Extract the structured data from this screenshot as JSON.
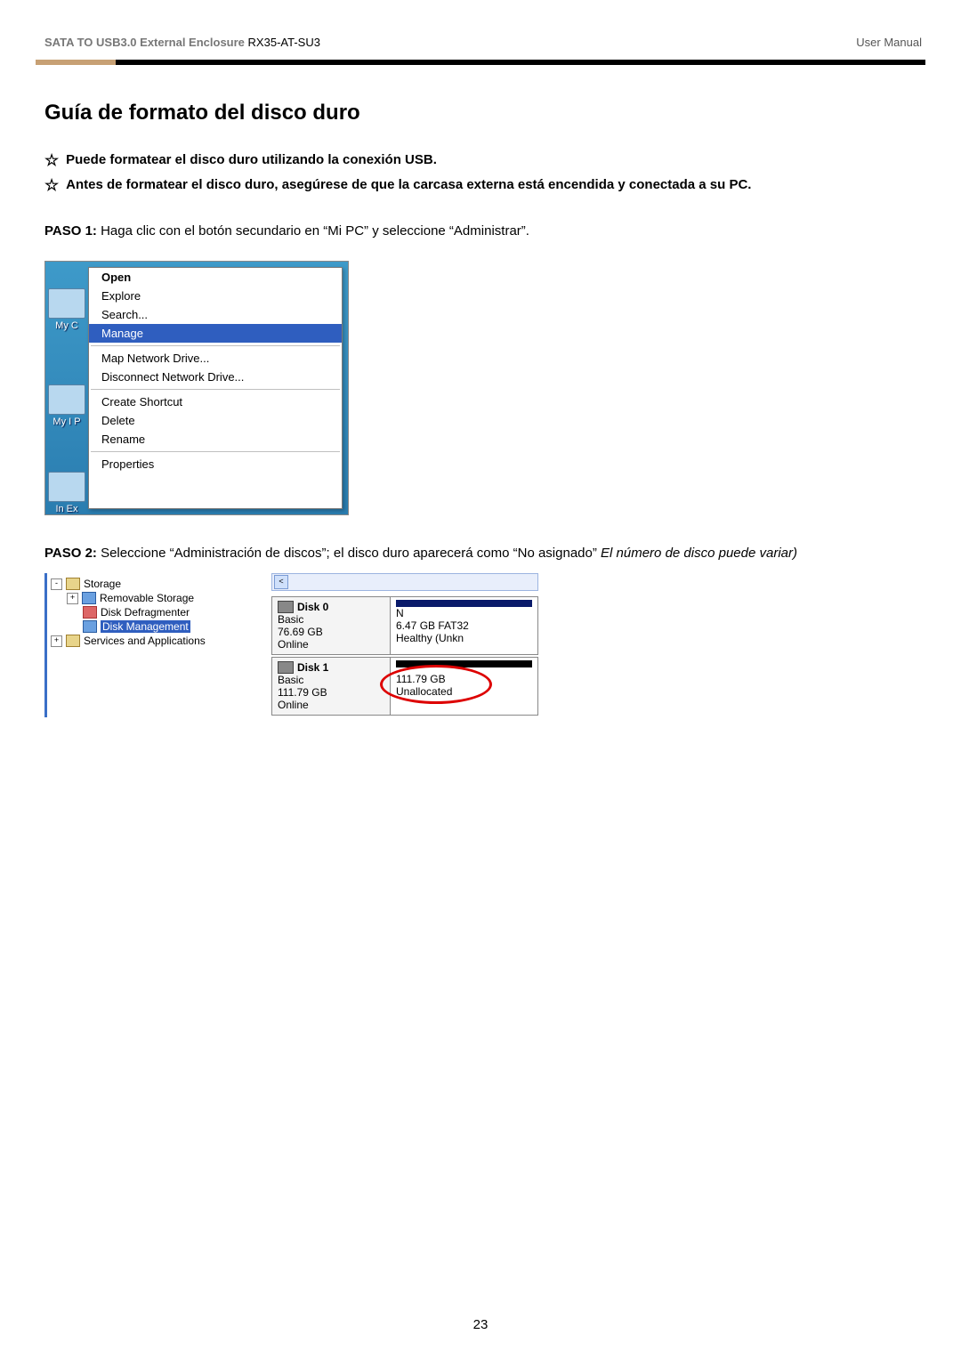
{
  "header": {
    "product_line": "SATA TO USB3.0 External Enclosure",
    "model": "RX35-AT-SU3",
    "doc_type": "User Manual"
  },
  "title": "Guía de formato del disco duro",
  "bullets": [
    "Puede formatear el disco duro utilizando la conexión USB.",
    "Antes de formatear el disco duro, asegúrese de que la carcasa externa está encendida y conectada a su PC."
  ],
  "step1": {
    "label": "PASO 1:",
    "text": " Haga clic con el botón secundario en “Mi PC” y seleccione “Administrar”."
  },
  "step2": {
    "label": "PASO 2:",
    "text": " Seleccione “Administración de discos”; el disco duro aparecerá como “No asignado” ",
    "italic": "El número de disco puede variar)"
  },
  "ctx": {
    "icons": [
      {
        "label": "My C"
      },
      {
        "label": "My I P"
      },
      {
        "label": "In Ex"
      }
    ],
    "items": [
      {
        "t": "Open",
        "bold": true
      },
      {
        "t": "Explore"
      },
      {
        "t": "Search..."
      },
      {
        "t": "Manage",
        "sel": true
      },
      {
        "hr": true
      },
      {
        "t": "Map Network Drive..."
      },
      {
        "t": "Disconnect Network Drive..."
      },
      {
        "hr": true
      },
      {
        "t": "Create Shortcut"
      },
      {
        "t": "Delete"
      },
      {
        "t": "Rename"
      },
      {
        "hr": true
      },
      {
        "t": "Properties"
      }
    ]
  },
  "tree": {
    "storage": "Storage",
    "removable": "Removable Storage",
    "defrag": "Disk Defragmenter",
    "diskmgmt": "Disk Management",
    "services": "Services and Applications"
  },
  "dm": {
    "disk0": {
      "name": "Disk 0",
      "type": "Basic",
      "size": "76.69 GB",
      "status": "Online",
      "part_label": "N",
      "part_size": "6.47 GB FAT32",
      "part_status": "Healthy (Unkn"
    },
    "disk1": {
      "name": "Disk 1",
      "type": "Basic",
      "size": "111.79 GB",
      "status": "Online",
      "part_size": "111.79 GB",
      "part_status": "Unallocated"
    }
  },
  "pagenum": "23"
}
